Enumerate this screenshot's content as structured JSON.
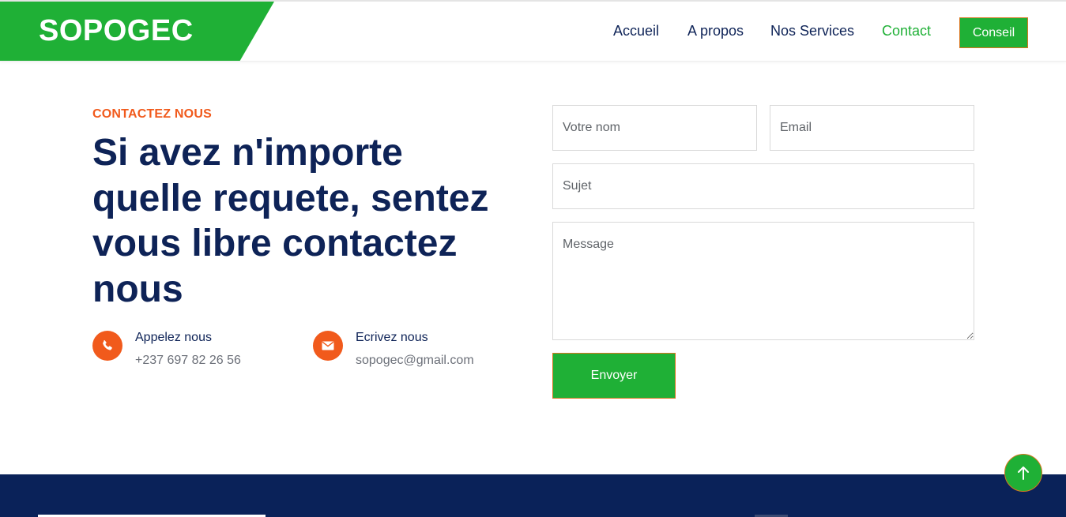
{
  "colors": {
    "brand_green": "#1fb036",
    "accent_orange": "#f15a1c",
    "navy": "#0e2357",
    "footer_navy": "#0a2259"
  },
  "header": {
    "logo": "SOPOGEC",
    "nav": [
      {
        "label": "Accueil",
        "active": false
      },
      {
        "label": "A propos",
        "active": false
      },
      {
        "label": "Nos Services",
        "active": false
      },
      {
        "label": "Contact",
        "active": true
      }
    ],
    "cta_label": "Conseil"
  },
  "contact": {
    "eyebrow": "CONTACTEZ NOUS",
    "headline": "Si avez n'importe quelle requete, sentez vous libre contactez nous",
    "phone": {
      "icon": "phone-icon",
      "title": "Appelez nous",
      "value": "+237 697 82 26 56"
    },
    "email": {
      "icon": "envelope-icon",
      "title": "Ecrivez nous",
      "value": "sopogec@gmail.com"
    }
  },
  "form": {
    "name_placeholder": "Votre nom",
    "email_placeholder": "Email",
    "subject_placeholder": "Sujet",
    "message_placeholder": "Message",
    "submit_label": "Envoyer"
  },
  "back_to_top_icon": "arrow-up-icon"
}
